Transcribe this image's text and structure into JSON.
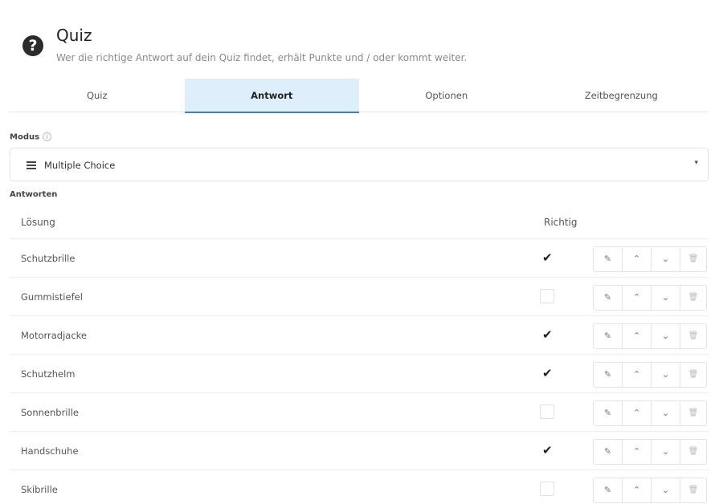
{
  "header": {
    "icon_glyph": "?",
    "title": "Quiz",
    "subtitle": "Wer die richtige Antwort auf dein Quiz findet, erhält Punkte und / oder kommt weiter."
  },
  "tabs": [
    {
      "label": "Quiz",
      "active": false
    },
    {
      "label": "Antwort",
      "active": true
    },
    {
      "label": "Optionen",
      "active": false
    },
    {
      "label": "Zeitbegrenzung",
      "active": false
    }
  ],
  "modus": {
    "label": "Modus",
    "info_glyph": "i",
    "selected": "Multiple Choice",
    "caret_glyph": "▾"
  },
  "answers": {
    "label": "Antworten",
    "col_solution": "Lösung",
    "col_correct": "Richtig",
    "edit_glyph": "✎",
    "up_glyph": "⌃",
    "down_glyph": "⌄",
    "delete_glyph": "🗑",
    "check_glyph": "✔",
    "rows": [
      {
        "label": "Schutzbrille",
        "correct": true
      },
      {
        "label": "Gummistiefel",
        "correct": false
      },
      {
        "label": "Motorradjacke",
        "correct": true
      },
      {
        "label": "Schutzhelm",
        "correct": true
      },
      {
        "label": "Sonnenbrille",
        "correct": false
      },
      {
        "label": "Handschuhe",
        "correct": true
      },
      {
        "label": "Skibrille",
        "correct": false
      }
    ]
  },
  "colors": {
    "active_tab_bg": "#dfeefb",
    "active_tab_border": "#3d7fc2"
  }
}
